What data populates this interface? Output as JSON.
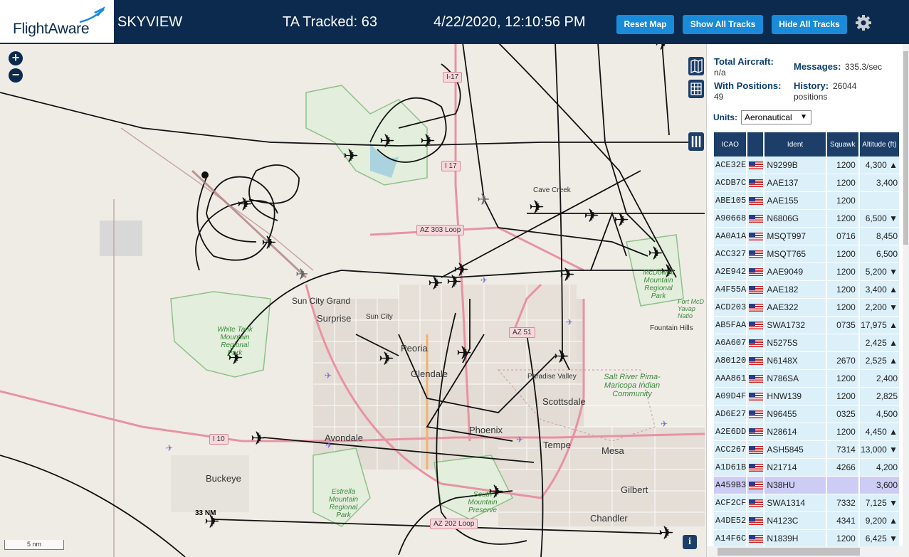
{
  "header": {
    "logo_text": "FlightAware",
    "app_name": "SKYVIEW",
    "tracked": "TA Tracked: 63",
    "datetime": "4/22/2020, 12:10:56 PM",
    "buttons": [
      "Reset Map",
      "Show All Tracks",
      "Hide All Tracks"
    ],
    "settings_icon": "gear-icon"
  },
  "map": {
    "zoom_in": "+",
    "zoom_out": "−",
    "scale": "5 nm",
    "info": "i",
    "places": [
      {
        "name": "Sun City Grand"
      },
      {
        "name": "Surprise"
      },
      {
        "name": "Sun City"
      },
      {
        "name": "Peoria"
      },
      {
        "name": "Glendale"
      },
      {
        "name": "Paradise Valley"
      },
      {
        "name": "Scottsdale"
      },
      {
        "name": "Phoenix"
      },
      {
        "name": "Avondale"
      },
      {
        "name": "Tempe"
      },
      {
        "name": "Mesa"
      },
      {
        "name": "Gilbert"
      },
      {
        "name": "Buckeye"
      },
      {
        "name": "Chandler"
      },
      {
        "name": "Cave Creek"
      },
      {
        "name": "Fountain Hills"
      }
    ],
    "parks": [
      {
        "name": "White Tank Mountain Regional Park"
      },
      {
        "name": "Salt River Pima-Maricopa Indian Community"
      },
      {
        "name": "Estrella Mountain Regional Park"
      },
      {
        "name": "McDowell Mountain Regional Park"
      },
      {
        "name": "South Mountain Preserve"
      },
      {
        "name": "Fort McD Yavap Natio"
      }
    ],
    "highways": [
      "I-17",
      "I 17",
      "AZ 303 Loop",
      "AZ 51",
      "I 10",
      "AZ 202 Loop"
    ],
    "range_label": "33 NM"
  },
  "stats": {
    "total_aircraft_label": "Total Aircraft:",
    "total_aircraft_value": "n/a",
    "with_positions_label": "With Positions:",
    "with_positions_value": "49",
    "messages_label": "Messages:",
    "messages_value": "335.3/sec",
    "history_label": "History:",
    "history_value": "26044",
    "history_unit": "positions",
    "units_label": "Units:",
    "units_value": "Aeronautical"
  },
  "table": {
    "headers": [
      "ICAO",
      "",
      "Ident",
      "Squawk",
      "Altitude (ft)"
    ],
    "rows": [
      {
        "icao": "ACE32E",
        "ident": "N9299B",
        "squawk": "1200",
        "alt": "4,300 ▲"
      },
      {
        "icao": "ACDB7C",
        "ident": "AAE137",
        "squawk": "1200",
        "alt": "3,400"
      },
      {
        "icao": "ABE105",
        "ident": "AAE155",
        "squawk": "1200",
        "alt": ""
      },
      {
        "icao": "A90668",
        "ident": "N6806G",
        "squawk": "1200",
        "alt": "6,500 ▼"
      },
      {
        "icao": "AA0A1A",
        "ident": "MSQT997",
        "squawk": "0716",
        "alt": "8,450"
      },
      {
        "icao": "ACC327",
        "ident": "MSQT765",
        "squawk": "1200",
        "alt": "6,500"
      },
      {
        "icao": "A2E942",
        "ident": "AAE9049",
        "squawk": "1200",
        "alt": "5,200 ▼"
      },
      {
        "icao": "A4F55A",
        "ident": "AAE182",
        "squawk": "1200",
        "alt": "3,400 ▲"
      },
      {
        "icao": "ACD203",
        "ident": "AAE322",
        "squawk": "1200",
        "alt": "2,200 ▼"
      },
      {
        "icao": "AB5FAA",
        "ident": "SWA1732",
        "squawk": "0735",
        "alt": "17,975 ▲"
      },
      {
        "icao": "A6A607",
        "ident": "N5275S",
        "squawk": "",
        "alt": "2,425 ▲"
      },
      {
        "icao": "A80120",
        "ident": "N6148X",
        "squawk": "2670",
        "alt": "2,525 ▲"
      },
      {
        "icao": "AAA861",
        "ident": "N786SA",
        "squawk": "1200",
        "alt": "2,400"
      },
      {
        "icao": "A09D4F",
        "ident": "HNW139",
        "squawk": "1200",
        "alt": "2,825"
      },
      {
        "icao": "AD6E27",
        "ident": "N96455",
        "squawk": "0325",
        "alt": "4,500"
      },
      {
        "icao": "A2E6DD",
        "ident": "N28614",
        "squawk": "1200",
        "alt": "4,450 ▲"
      },
      {
        "icao": "ACC267",
        "ident": "ASH5845",
        "squawk": "7314",
        "alt": "13,000 ▼"
      },
      {
        "icao": "A1D61B",
        "ident": "N21714",
        "squawk": "4266",
        "alt": "4,200"
      },
      {
        "icao": "A459B3",
        "ident": "N38HU",
        "squawk": "",
        "alt": "3,600"
      },
      {
        "icao": "ACF2CF",
        "ident": "SWA1314",
        "squawk": "7332",
        "alt": "7,125 ▼"
      },
      {
        "icao": "A4DE52",
        "ident": "N4123C",
        "squawk": "4341",
        "alt": "9,200 ▲"
      },
      {
        "icao": "A14F6C",
        "ident": "N1839H",
        "squawk": "1200",
        "alt": "6,425 ▼"
      }
    ]
  }
}
